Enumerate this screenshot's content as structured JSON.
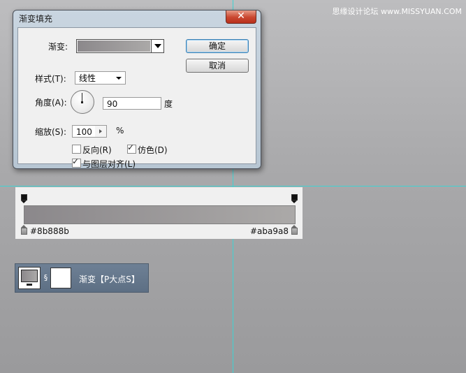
{
  "watermark": "思缘设计论坛 www.MISSYUAN.COM",
  "dialog": {
    "title": "渐变填充",
    "close_glyph": "✕",
    "gradient_label": "渐变:",
    "style_label": "样式(T):",
    "style_value": "线性",
    "angle_label": "角度(A):",
    "angle_value": "90",
    "angle_unit": "度",
    "scale_label": "缩放(S):",
    "scale_value": "100",
    "scale_unit": "%",
    "reverse_label": "反向(R)",
    "reverse_checked": false,
    "dither_label": "仿色(D)",
    "dither_checked": true,
    "align_label": "与图层对齐(L)",
    "align_checked": true,
    "ok_label": "确定",
    "cancel_label": "取消"
  },
  "gradient_editor": {
    "left_color": "#8b888b",
    "right_color": "#aba9a8"
  },
  "layer": {
    "name": "渐变【P大点S】",
    "link_glyph": "§"
  },
  "colors": {
    "guide": "#3ed3d3",
    "gradient_start": "#8b888b",
    "gradient_end": "#aba9a8"
  }
}
